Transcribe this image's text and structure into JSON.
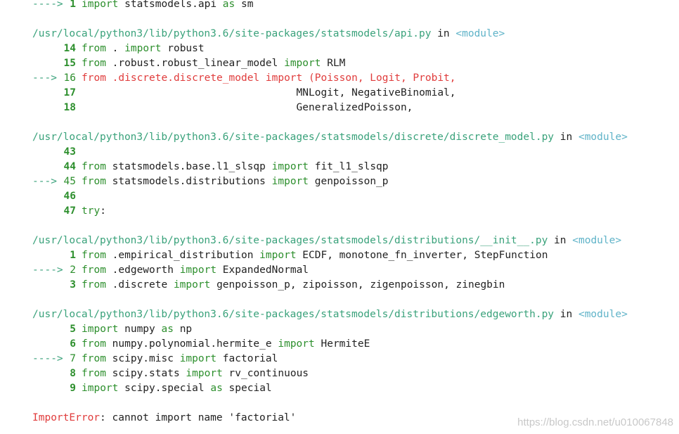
{
  "lines": [
    {
      "kind": "frameline",
      "arrow": "---->",
      "num": "1",
      "tokens": [
        [
          "kw",
          "import"
        ],
        [
          "t",
          " statsmodels.api "
        ],
        [
          "kw",
          "as"
        ],
        [
          "t",
          " sm"
        ]
      ]
    },
    {
      "kind": "blank"
    },
    {
      "kind": "header",
      "path": "/usr/local/python3/lib/python3.6/site-packages/statsmodels/api.py",
      "in": "in",
      "module": "<module>"
    },
    {
      "kind": "frameline",
      "num": "14",
      "tokens": [
        [
          "kw",
          "from"
        ],
        [
          "t",
          " . "
        ],
        [
          "kw",
          "import"
        ],
        [
          "t",
          " robust"
        ]
      ]
    },
    {
      "kind": "frameline",
      "num": "15",
      "tokens": [
        [
          "kw",
          "from"
        ],
        [
          "t",
          " .robust.robust_linear_model "
        ],
        [
          "kw",
          "import"
        ],
        [
          "t",
          " RLM"
        ]
      ]
    },
    {
      "kind": "frameline",
      "current": true,
      "arrow": "--->",
      "num": "16",
      "tokens": [
        [
          "hl",
          "from .discrete.discrete_model import (Poisson, Logit, Probit,"
        ]
      ]
    },
    {
      "kind": "frameline",
      "num": "17",
      "tokens": [
        [
          "t",
          "                                   MNLogit, NegativeBinomial,"
        ]
      ]
    },
    {
      "kind": "frameline",
      "num": "18",
      "tokens": [
        [
          "t",
          "                                   GeneralizedPoisson,"
        ]
      ]
    },
    {
      "kind": "blank"
    },
    {
      "kind": "header",
      "path": "/usr/local/python3/lib/python3.6/site-packages/statsmodels/discrete/discrete_model.py",
      "in": "in",
      "module": "<module>"
    },
    {
      "kind": "frameline",
      "num": "43",
      "tokens": []
    },
    {
      "kind": "frameline",
      "num": "44",
      "tokens": [
        [
          "kw",
          "from"
        ],
        [
          "t",
          " statsmodels.base.l1_slsqp "
        ],
        [
          "kw",
          "import"
        ],
        [
          "t",
          " fit_l1_slsqp"
        ]
      ]
    },
    {
      "kind": "frameline",
      "current": true,
      "arrow": "--->",
      "num": "45",
      "tokens": [
        [
          "kw",
          "from"
        ],
        [
          "t",
          " statsmodels.distributions "
        ],
        [
          "kw",
          "import"
        ],
        [
          "t",
          " genpoisson_p"
        ]
      ]
    },
    {
      "kind": "frameline",
      "num": "46",
      "tokens": []
    },
    {
      "kind": "frameline",
      "num": "47",
      "tokens": [
        [
          "kw",
          "try"
        ],
        [
          "t",
          ":"
        ]
      ]
    },
    {
      "kind": "blank"
    },
    {
      "kind": "header",
      "path": "/usr/local/python3/lib/python3.6/site-packages/statsmodels/distributions/__init__.py",
      "in": "in",
      "module": "<module>"
    },
    {
      "kind": "frameline",
      "num": "1",
      "tokens": [
        [
          "kw",
          "from"
        ],
        [
          "t",
          " .empirical_distribution "
        ],
        [
          "kw",
          "import"
        ],
        [
          "t",
          " ECDF, monotone_fn_inverter, StepFunction"
        ]
      ]
    },
    {
      "kind": "frameline",
      "current": true,
      "arrow": "---->",
      "num": "2",
      "tokens": [
        [
          "kw",
          "from"
        ],
        [
          "t",
          " .edgeworth "
        ],
        [
          "kw",
          "import"
        ],
        [
          "t",
          " ExpandedNormal"
        ]
      ]
    },
    {
      "kind": "frameline",
      "num": "3",
      "tokens": [
        [
          "kw",
          "from"
        ],
        [
          "t",
          " .discrete "
        ],
        [
          "kw",
          "import"
        ],
        [
          "t",
          " genpoisson_p, zipoisson, zigenpoisson, zinegbin"
        ]
      ]
    },
    {
      "kind": "blank"
    },
    {
      "kind": "header",
      "path": "/usr/local/python3/lib/python3.6/site-packages/statsmodels/distributions/edgeworth.py",
      "in": "in",
      "module": "<module>"
    },
    {
      "kind": "frameline",
      "num": "5",
      "tokens": [
        [
          "kw",
          "import"
        ],
        [
          "t",
          " numpy "
        ],
        [
          "kw",
          "as"
        ],
        [
          "t",
          " np"
        ]
      ]
    },
    {
      "kind": "frameline",
      "num": "6",
      "tokens": [
        [
          "kw",
          "from"
        ],
        [
          "t",
          " numpy.polynomial.hermite_e "
        ],
        [
          "kw",
          "import"
        ],
        [
          "t",
          " HermiteE"
        ]
      ]
    },
    {
      "kind": "frameline",
      "current": true,
      "arrow": "---->",
      "num": "7",
      "tokens": [
        [
          "kw",
          "from"
        ],
        [
          "t",
          " scipy.misc "
        ],
        [
          "kw",
          "import"
        ],
        [
          "t",
          " factorial"
        ]
      ]
    },
    {
      "kind": "frameline",
      "num": "8",
      "tokens": [
        [
          "kw",
          "from"
        ],
        [
          "t",
          " scipy.stats "
        ],
        [
          "kw",
          "import"
        ],
        [
          "t",
          " rv_continuous"
        ]
      ]
    },
    {
      "kind": "frameline",
      "num": "9",
      "tokens": [
        [
          "kw",
          "import"
        ],
        [
          "t",
          " scipy.special "
        ],
        [
          "kw",
          "as"
        ],
        [
          "t",
          " special"
        ]
      ]
    },
    {
      "kind": "blank"
    },
    {
      "kind": "error",
      "type": "ImportError",
      "message": ": cannot import name 'factorial'"
    }
  ],
  "watermark": "https://blog.csdn.net/u010067848"
}
